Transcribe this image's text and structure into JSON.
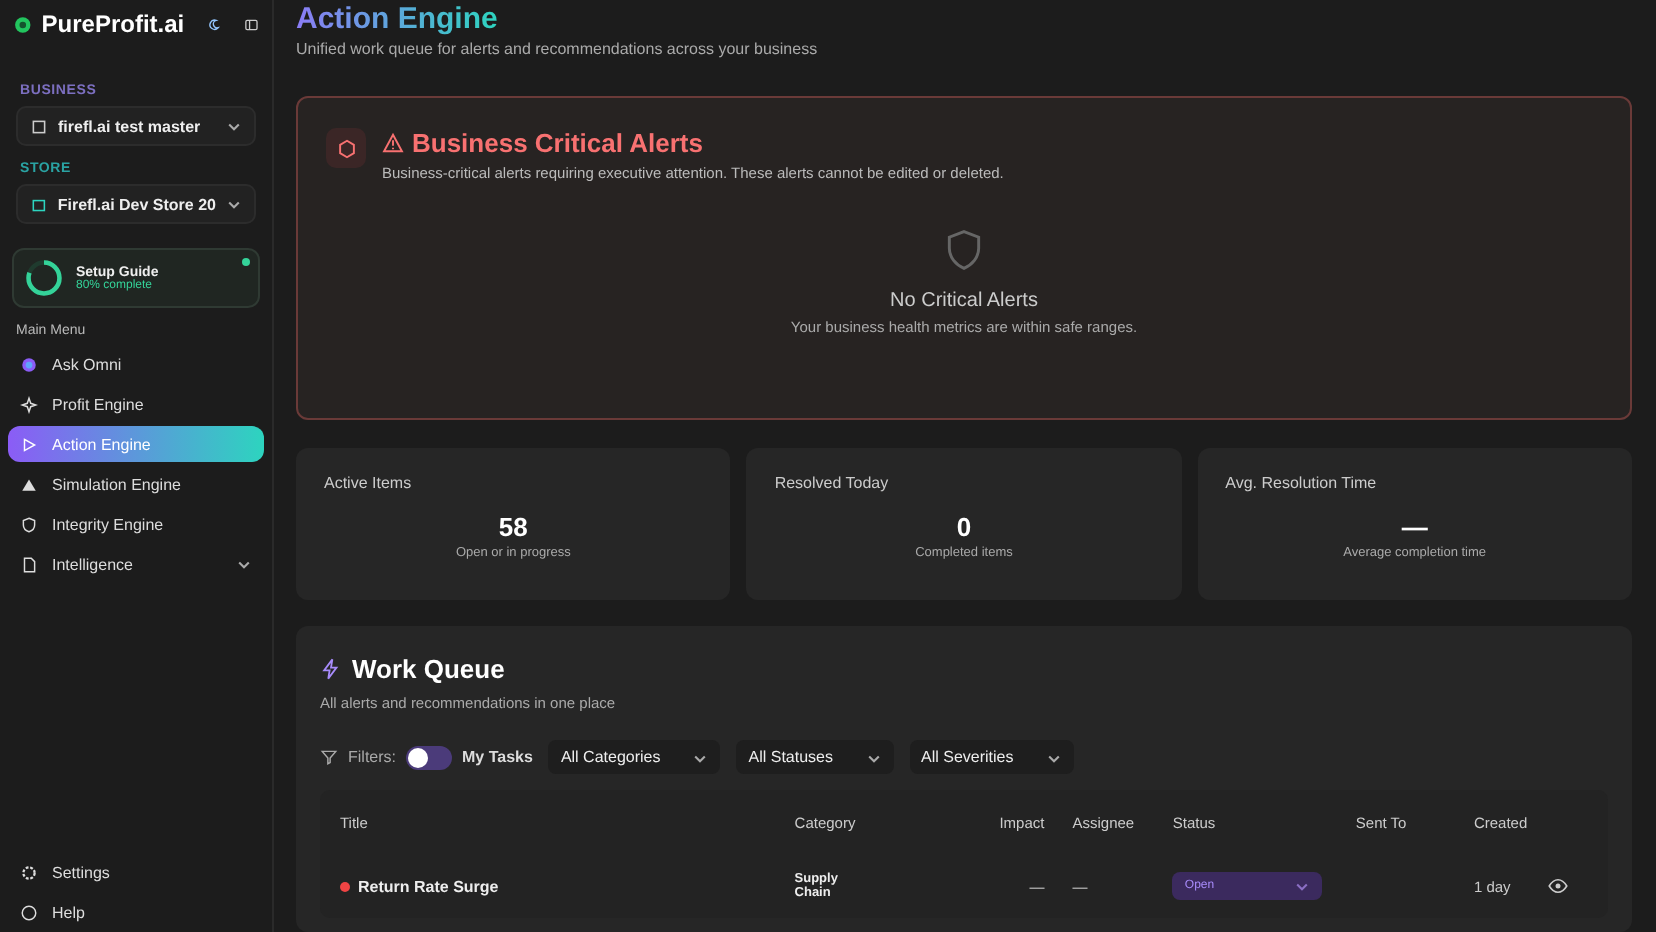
{
  "sidebar": {
    "brand": "PureProfit.ai",
    "business_label": "BUSINESS",
    "business": "firefl.ai test master",
    "store_label": "STORE",
    "store": "Firefl.ai Dev Store 20",
    "setup": {
      "title": "Setup Guide",
      "progress": "80% complete",
      "level": 0.8
    },
    "menu_label": "Main Menu",
    "items": [
      {
        "label": "Ask Omni",
        "kind": "link",
        "selected": false
      },
      {
        "label": "Profit Engine",
        "kind": "link",
        "selected": false
      },
      {
        "label": "Action Engine",
        "kind": "link",
        "selected": true
      },
      {
        "label": "Simulation Engine",
        "kind": "link",
        "selected": false
      },
      {
        "label": "Integrity Engine",
        "kind": "link",
        "selected": false
      },
      {
        "label": "Intelligence",
        "kind": "group",
        "selected": false
      }
    ],
    "footer": [
      {
        "label": "Settings"
      },
      {
        "label": "Help"
      }
    ]
  },
  "page": {
    "title": "Action Engine",
    "subtitle": "Unified work queue for alerts and recommendations across your business"
  },
  "alerts": {
    "title": "Business Critical Alerts",
    "description": "Business-critical alerts requiring executive attention. These alerts cannot be edited or deleted.",
    "empty_title": "No Critical Alerts",
    "empty_text": "Your business health metrics are within safe ranges."
  },
  "stats": [
    {
      "label": "Active Items",
      "value": "58",
      "caption": "Open or in progress"
    },
    {
      "label": "Resolved Today",
      "value": "0",
      "caption": "Completed items"
    },
    {
      "label": "Avg. Resolution Time",
      "value": "—",
      "caption": "Average completion time"
    }
  ],
  "work_queue": {
    "title": "Work Queue",
    "subtitle": "All alerts and recommendations in one place",
    "filters_label": "Filters:",
    "my_tasks": {
      "label": "My Tasks",
      "on": false
    },
    "dropdowns": [
      "All Categories",
      "All Statuses",
      "All Severities"
    ],
    "columns": [
      "Title",
      "Category",
      "Impact",
      "Assignee",
      "Status",
      "Sent To",
      "Created"
    ],
    "rows": [
      {
        "title": "Return Rate Surge",
        "color": "#ef4444",
        "category": "Supply Chain",
        "impact": "—",
        "assignee": "—",
        "status": "Open",
        "created": "1 day"
      }
    ]
  }
}
